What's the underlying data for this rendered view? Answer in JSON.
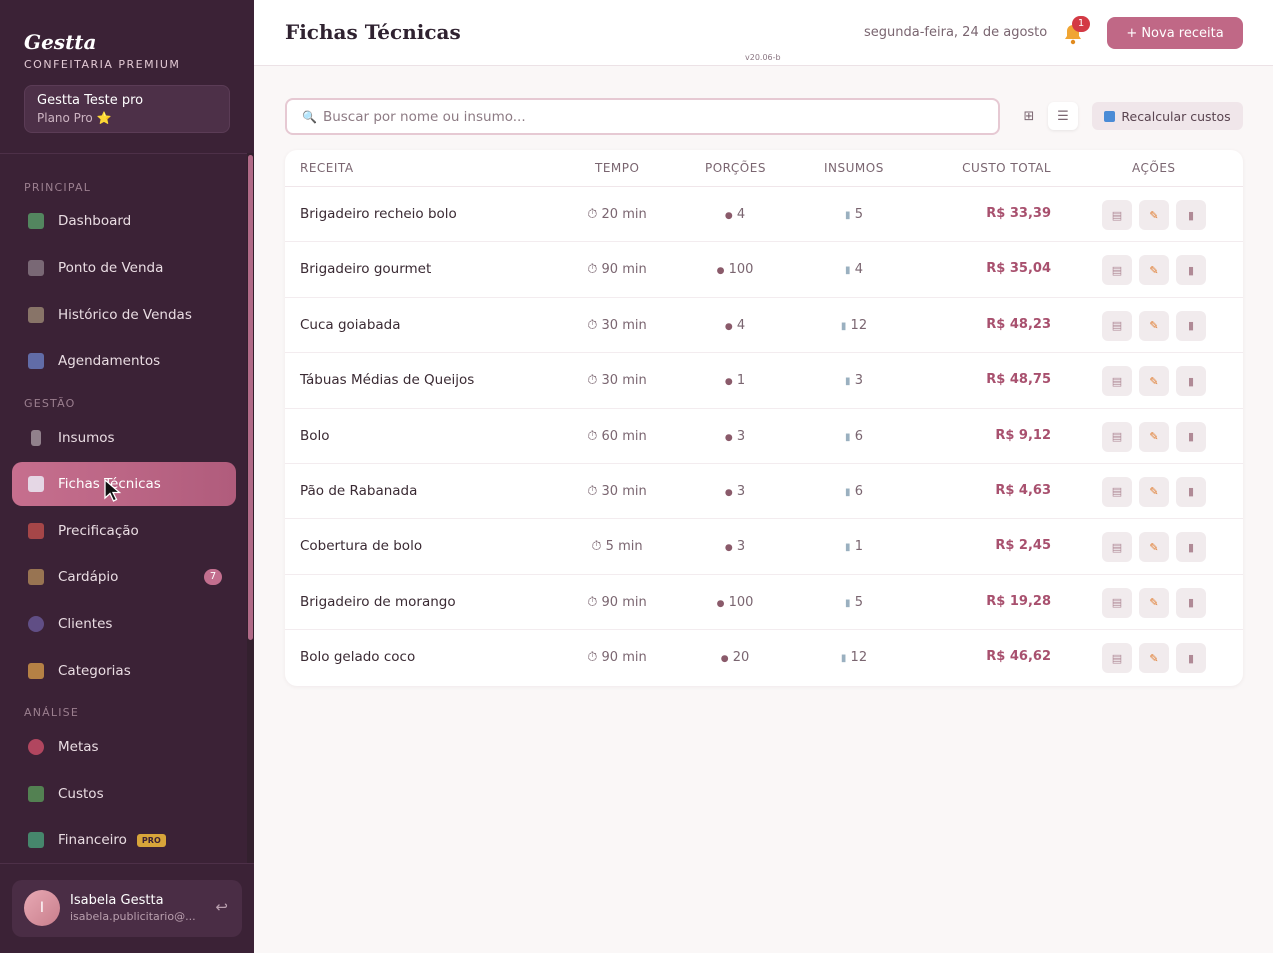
{
  "sidebar": {
    "brand": "Gestta",
    "brand_sub": "CONFEITARIA PREMIUM",
    "account_name": "Gestta Teste pro",
    "account_plan": "Plano Pro ⭐",
    "sections": [
      "PRINCIPAL",
      "GESTÃO",
      "ANÁLISE"
    ],
    "items": [
      {
        "label": "Dashboard",
        "icon": "chart-icon"
      },
      {
        "label": "Ponto de Venda",
        "icon": "cart-icon"
      },
      {
        "label": "Histórico de Vendas",
        "icon": "receipt-icon"
      },
      {
        "label": "Agendamentos",
        "icon": "calendar-icon"
      },
      {
        "label": "Insumos",
        "icon": "jar-icon"
      },
      {
        "label": "Fichas Técnicas",
        "icon": "book-icon"
      },
      {
        "label": "Precificação",
        "icon": "calculator-icon"
      },
      {
        "label": "Cardápio",
        "icon": "menu-icon",
        "badge": "7"
      },
      {
        "label": "Clientes",
        "icon": "people-icon"
      },
      {
        "label": "Categorias",
        "icon": "tag-icon"
      },
      {
        "label": "Metas",
        "icon": "target-icon"
      },
      {
        "label": "Custos",
        "icon": "money-icon"
      },
      {
        "label": "Financeiro",
        "icon": "chart-up-icon",
        "badge": "PRO"
      }
    ],
    "user": {
      "initial": "I",
      "name": "Isabela Gestta",
      "email": "isabela.publicitario@..."
    }
  },
  "header": {
    "title": "Fichas Técnicas",
    "date": "segunda-feira, 24 de agosto",
    "notifications": "1",
    "new_button": "+   Nova receita",
    "version": "v20.06-b"
  },
  "toolbar": {
    "search_placeholder": "Buscar por nome ou insumo...",
    "grid_icon": "⊞",
    "list_icon": "☰",
    "recalc_label": "Recalcular custos"
  },
  "table": {
    "headers": [
      "RECEITA",
      "TEMPO",
      "PORÇÕES",
      "INSUMOS",
      "CUSTO TOTAL",
      "AÇÕES"
    ],
    "rows": [
      {
        "name": "Brigadeiro recheio bolo",
        "time": "20 min",
        "portions": "4",
        "inputs": "5",
        "cost": "R$ 33,39"
      },
      {
        "name": "Brigadeiro gourmet",
        "time": "90 min",
        "portions": "100",
        "inputs": "4",
        "cost": "R$ 35,04"
      },
      {
        "name": "Cuca goiabada",
        "time": "30 min",
        "portions": "4",
        "inputs": "12",
        "cost": "R$ 48,23"
      },
      {
        "name": "Tábuas Médias de Queijos",
        "time": "30 min",
        "portions": "1",
        "inputs": "3",
        "cost": "R$ 48,75"
      },
      {
        "name": "Bolo",
        "time": "60 min",
        "portions": "3",
        "inputs": "6",
        "cost": "R$ 9,12"
      },
      {
        "name": "Pão de Rabanada",
        "time": "30 min",
        "portions": "3",
        "inputs": "6",
        "cost": "R$ 4,63"
      },
      {
        "name": "Cobertura de bolo",
        "time": "5 min",
        "portions": "3",
        "inputs": "1",
        "cost": "R$ 2,45"
      },
      {
        "name": "Brigadeiro de morango",
        "time": "90 min",
        "portions": "100",
        "inputs": "5",
        "cost": "R$ 19,28"
      },
      {
        "name": "Bolo gelado coco",
        "time": "90 min",
        "portions": "20",
        "inputs": "12",
        "cost": "R$ 46,62"
      }
    ]
  },
  "colors": {
    "sidebar": "#3b2236",
    "accent": "#c06886",
    "cost": "#a8506e"
  }
}
